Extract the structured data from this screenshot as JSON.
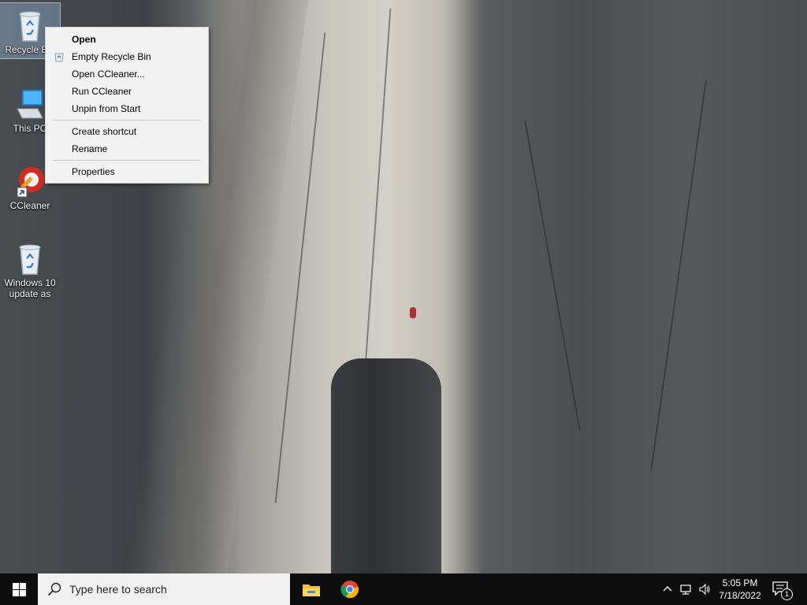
{
  "desktop": {
    "icons": [
      {
        "label": "Recycle Bin",
        "icon": "recycle-bin-icon"
      },
      {
        "label": "This PC",
        "icon": "computer-icon"
      },
      {
        "label": "CCleaner",
        "icon": "ccleaner-icon"
      },
      {
        "label": "Windows 10 update as",
        "icon": "recycle-bin-icon"
      }
    ]
  },
  "context_menu": {
    "items": [
      {
        "label": "Open",
        "bold": true
      },
      {
        "label": "Empty Recycle Bin",
        "icon": "recycle-bin-small-icon"
      },
      {
        "label": "Open CCleaner..."
      },
      {
        "label": "Run CCleaner"
      },
      {
        "label": "Unpin from Start"
      },
      {
        "label": "Create shortcut"
      },
      {
        "label": "Rename"
      },
      {
        "label": "Properties"
      }
    ]
  },
  "taskbar": {
    "search_placeholder": "Type here to search",
    "apps": [
      {
        "name": "file-explorer-icon"
      },
      {
        "name": "chrome-icon"
      }
    ],
    "clock_time": "5:05 PM",
    "clock_date": "7/18/2022",
    "notification_count": "1",
    "colors": {
      "taskbar_bg": "#0d0d0d",
      "search_bg": "#f0f0f0",
      "menu_bg": "#f2f2f2"
    }
  }
}
